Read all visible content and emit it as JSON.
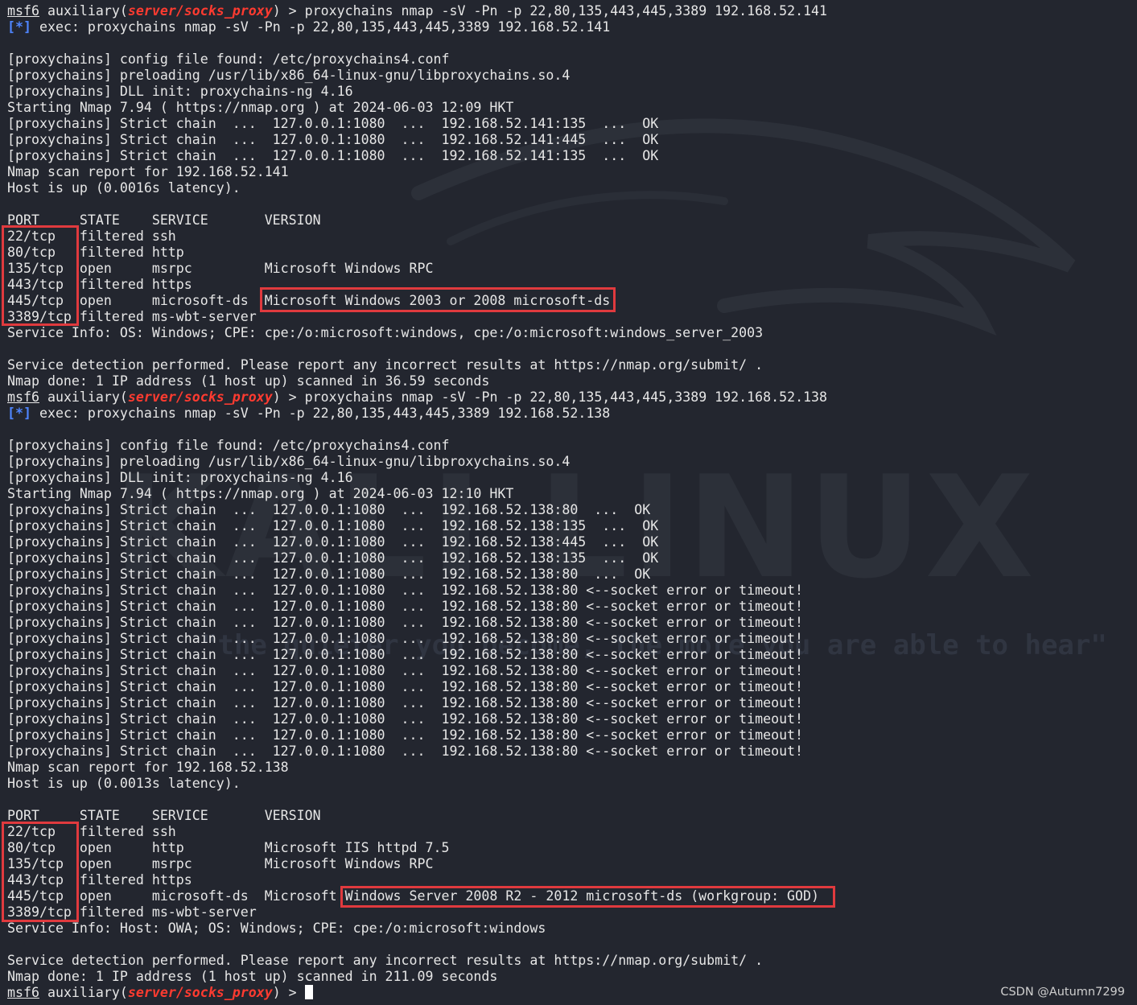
{
  "prompt": {
    "msf": "msf6",
    "auxiliary": " auxiliary(",
    "module": "server/socks_proxy",
    "close": ") > "
  },
  "info_tag": "[*]",
  "watermark": {
    "logo": "KALI LINUX",
    "quote": "\"the quieter you become, the more you are able to hear\""
  },
  "credit": "CSDN @Autumn7299",
  "lines": [
    {
      "t": "prompt",
      "cmd": "proxychains nmap -sV -Pn -p 22,80,135,443,445,3389 192.168.52.141"
    },
    {
      "t": "info",
      "text": " exec: proxychains nmap -sV -Pn -p 22,80,135,443,445,3389 192.168.52.141"
    },
    {
      "t": "text",
      "text": ""
    },
    {
      "t": "text",
      "text": "[proxychains] config file found: /etc/proxychains4.conf"
    },
    {
      "t": "text",
      "text": "[proxychains] preloading /usr/lib/x86_64-linux-gnu/libproxychains.so.4"
    },
    {
      "t": "text",
      "text": "[proxychains] DLL init: proxychains-ng 4.16"
    },
    {
      "t": "text",
      "text": "Starting Nmap 7.94 ( https://nmap.org ) at 2024-06-03 12:09 HKT"
    },
    {
      "t": "text",
      "text": "[proxychains] Strict chain  ...  127.0.0.1:1080  ...  192.168.52.141:135  ...  OK"
    },
    {
      "t": "text",
      "text": "[proxychains] Strict chain  ...  127.0.0.1:1080  ...  192.168.52.141:445  ...  OK"
    },
    {
      "t": "text",
      "text": "[proxychains] Strict chain  ...  127.0.0.1:1080  ...  192.168.52.141:135  ...  OK"
    },
    {
      "t": "text",
      "text": "Nmap scan report for 192.168.52.141"
    },
    {
      "t": "text",
      "text": "Host is up (0.0016s latency)."
    },
    {
      "t": "text",
      "text": ""
    },
    {
      "t": "text",
      "text": "PORT     STATE    SERVICE       VERSION"
    },
    {
      "t": "text",
      "text": "22/tcp   filtered ssh"
    },
    {
      "t": "text",
      "text": "80/tcp   filtered http"
    },
    {
      "t": "text",
      "text": "135/tcp  open     msrpc         Microsoft Windows RPC"
    },
    {
      "t": "text",
      "text": "443/tcp  filtered https"
    },
    {
      "t": "text",
      "text": "445/tcp  open     microsoft-ds  Microsoft Windows 2003 or 2008 microsoft-ds"
    },
    {
      "t": "text",
      "text": "3389/tcp filtered ms-wbt-server"
    },
    {
      "t": "text",
      "text": "Service Info: OS: Windows; CPE: cpe:/o:microsoft:windows, cpe:/o:microsoft:windows_server_2003"
    },
    {
      "t": "text",
      "text": ""
    },
    {
      "t": "text",
      "text": "Service detection performed. Please report any incorrect results at https://nmap.org/submit/ ."
    },
    {
      "t": "text",
      "text": "Nmap done: 1 IP address (1 host up) scanned in 36.59 seconds"
    },
    {
      "t": "prompt",
      "cmd": "proxychains nmap -sV -Pn -p 22,80,135,443,445,3389 192.168.52.138"
    },
    {
      "t": "info",
      "text": " exec: proxychains nmap -sV -Pn -p 22,80,135,443,445,3389 192.168.52.138"
    },
    {
      "t": "text",
      "text": ""
    },
    {
      "t": "text",
      "text": "[proxychains] config file found: /etc/proxychains4.conf"
    },
    {
      "t": "text",
      "text": "[proxychains] preloading /usr/lib/x86_64-linux-gnu/libproxychains.so.4"
    },
    {
      "t": "text",
      "text": "[proxychains] DLL init: proxychains-ng 4.16"
    },
    {
      "t": "text",
      "text": "Starting Nmap 7.94 ( https://nmap.org ) at 2024-06-03 12:10 HKT"
    },
    {
      "t": "text",
      "text": "[proxychains] Strict chain  ...  127.0.0.1:1080  ...  192.168.52.138:80  ...  OK"
    },
    {
      "t": "text",
      "text": "[proxychains] Strict chain  ...  127.0.0.1:1080  ...  192.168.52.138:135  ...  OK"
    },
    {
      "t": "text",
      "text": "[proxychains] Strict chain  ...  127.0.0.1:1080  ...  192.168.52.138:445  ...  OK"
    },
    {
      "t": "text",
      "text": "[proxychains] Strict chain  ...  127.0.0.1:1080  ...  192.168.52.138:135  ...  OK"
    },
    {
      "t": "text",
      "text": "[proxychains] Strict chain  ...  127.0.0.1:1080  ...  192.168.52.138:80  ...  OK"
    },
    {
      "t": "text",
      "text": "[proxychains] Strict chain  ...  127.0.0.1:1080  ...  192.168.52.138:80 <--socket error or timeout!"
    },
    {
      "t": "text",
      "text": "[proxychains] Strict chain  ...  127.0.0.1:1080  ...  192.168.52.138:80 <--socket error or timeout!"
    },
    {
      "t": "text",
      "text": "[proxychains] Strict chain  ...  127.0.0.1:1080  ...  192.168.52.138:80 <--socket error or timeout!"
    },
    {
      "t": "text",
      "text": "[proxychains] Strict chain  ...  127.0.0.1:1080  ...  192.168.52.138:80 <--socket error or timeout!"
    },
    {
      "t": "text",
      "text": "[proxychains] Strict chain  ...  127.0.0.1:1080  ...  192.168.52.138:80 <--socket error or timeout!"
    },
    {
      "t": "text",
      "text": "[proxychains] Strict chain  ...  127.0.0.1:1080  ...  192.168.52.138:80 <--socket error or timeout!"
    },
    {
      "t": "text",
      "text": "[proxychains] Strict chain  ...  127.0.0.1:1080  ...  192.168.52.138:80 <--socket error or timeout!"
    },
    {
      "t": "text",
      "text": "[proxychains] Strict chain  ...  127.0.0.1:1080  ...  192.168.52.138:80 <--socket error or timeout!"
    },
    {
      "t": "text",
      "text": "[proxychains] Strict chain  ...  127.0.0.1:1080  ...  192.168.52.138:80 <--socket error or timeout!"
    },
    {
      "t": "text",
      "text": "[proxychains] Strict chain  ...  127.0.0.1:1080  ...  192.168.52.138:80 <--socket error or timeout!"
    },
    {
      "t": "text",
      "text": "[proxychains] Strict chain  ...  127.0.0.1:1080  ...  192.168.52.138:80 <--socket error or timeout!"
    },
    {
      "t": "text",
      "text": "Nmap scan report for 192.168.52.138"
    },
    {
      "t": "text",
      "text": "Host is up (0.0013s latency)."
    },
    {
      "t": "text",
      "text": ""
    },
    {
      "t": "text",
      "text": "PORT     STATE    SERVICE       VERSION"
    },
    {
      "t": "text",
      "text": "22/tcp   filtered ssh"
    },
    {
      "t": "text",
      "text": "80/tcp   open     http          Microsoft IIS httpd 7.5"
    },
    {
      "t": "text",
      "text": "135/tcp  open     msrpc         Microsoft Windows RPC"
    },
    {
      "t": "text",
      "text": "443/tcp  filtered https"
    },
    {
      "t": "text",
      "text": "445/tcp  open     microsoft-ds  Microsoft Windows Server 2008 R2 - 2012 microsoft-ds (workgroup: GOD)"
    },
    {
      "t": "text",
      "text": "3389/tcp filtered ms-wbt-server"
    },
    {
      "t": "text",
      "text": "Service Info: Host: OWA; OS: Windows; CPE: cpe:/o:microsoft:windows"
    },
    {
      "t": "text",
      "text": ""
    },
    {
      "t": "text",
      "text": "Service detection performed. Please report any incorrect results at https://nmap.org/submit/ ."
    },
    {
      "t": "text",
      "text": "Nmap done: 1 IP address (1 host up) scanned in 211.09 seconds"
    },
    {
      "t": "prompt",
      "cmd": ""
    }
  ]
}
